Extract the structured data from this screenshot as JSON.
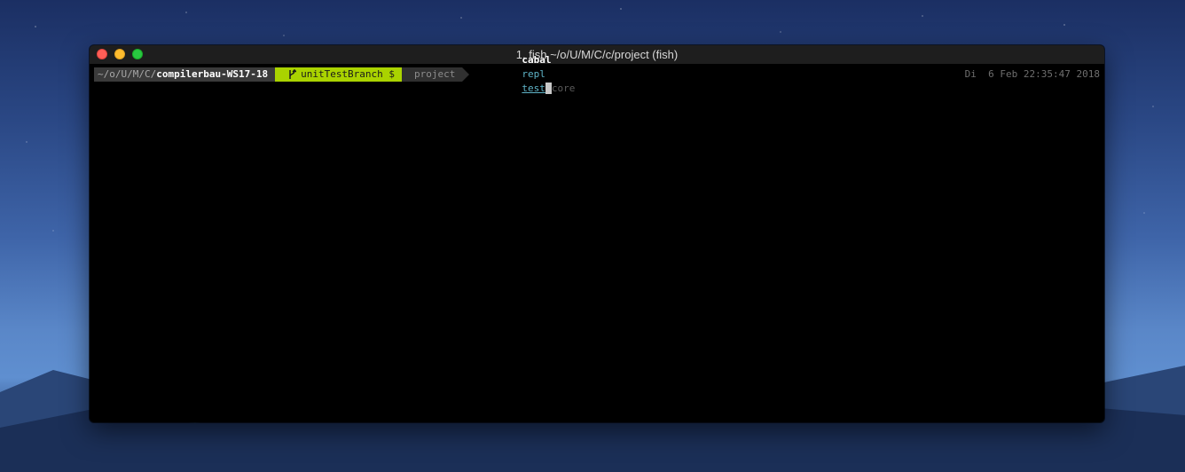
{
  "window": {
    "title": "1. fish ~/o/U/M/C/c/project (fish)"
  },
  "prompt": {
    "path_prefix": "~/o/U/M/C/",
    "path_current": "compilerbau-WS17-18",
    "git_icon": "git-branch-icon",
    "git_branch": "unitTestBranch $",
    "project_label": "project"
  },
  "command": {
    "program": "cabal",
    "arg1": "repl",
    "arg2_typed": "test",
    "arg2_suggestion": "core"
  },
  "clock": {
    "text": "Di  6 Feb 22:35:47 2018"
  },
  "colors": {
    "git_segment": "#aad300",
    "path_segment": "#3a3a3a",
    "command_highlight": "#5fb4c8"
  }
}
